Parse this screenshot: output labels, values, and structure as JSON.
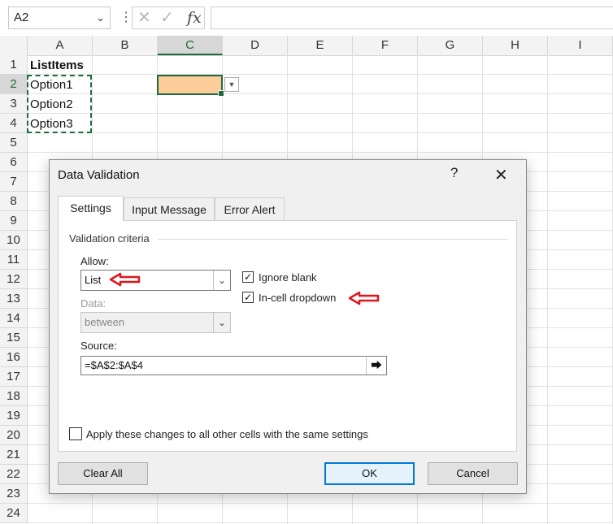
{
  "formula_bar": {
    "name_box": "A2",
    "formula": ""
  },
  "columns": [
    "A",
    "B",
    "C",
    "D",
    "E",
    "F",
    "G",
    "H",
    "I"
  ],
  "selected_column": "C",
  "rows": [
    "1",
    "2",
    "3",
    "4",
    "5",
    "6",
    "7",
    "8",
    "9",
    "10",
    "11",
    "12",
    "13",
    "14",
    "15",
    "16",
    "17",
    "18",
    "19",
    "20",
    "21",
    "22",
    "23",
    "24"
  ],
  "selected_row": "2",
  "cells": {
    "A1": "ListItems",
    "A2": "Option1",
    "A3": "Option2",
    "A4": "Option3"
  },
  "dialog": {
    "title": "Data Validation",
    "help": "?",
    "tabs": [
      "Settings",
      "Input Message",
      "Error Alert"
    ],
    "active_tab": "Settings",
    "group_label": "Validation criteria",
    "allow_label": "Allow:",
    "allow_value": "List",
    "data_label": "Data:",
    "data_value": "between",
    "ignore_blank_label": "Ignore blank",
    "ignore_blank_checked": true,
    "incell_dropdown_label": "In-cell dropdown",
    "incell_dropdown_checked": true,
    "source_label": "Source:",
    "source_value": "=$A$2:$A$4",
    "apply_all_label": "Apply these changes to all other cells with the same settings",
    "apply_all_checked": false,
    "clear_all_label": "Clear All",
    "ok_label": "OK",
    "cancel_label": "Cancel"
  },
  "colors": {
    "accent_green": "#1d6b3c",
    "selected_fill": "#fccd9a",
    "annotation_red": "#e0161d",
    "focus_blue": "#0078d7"
  }
}
